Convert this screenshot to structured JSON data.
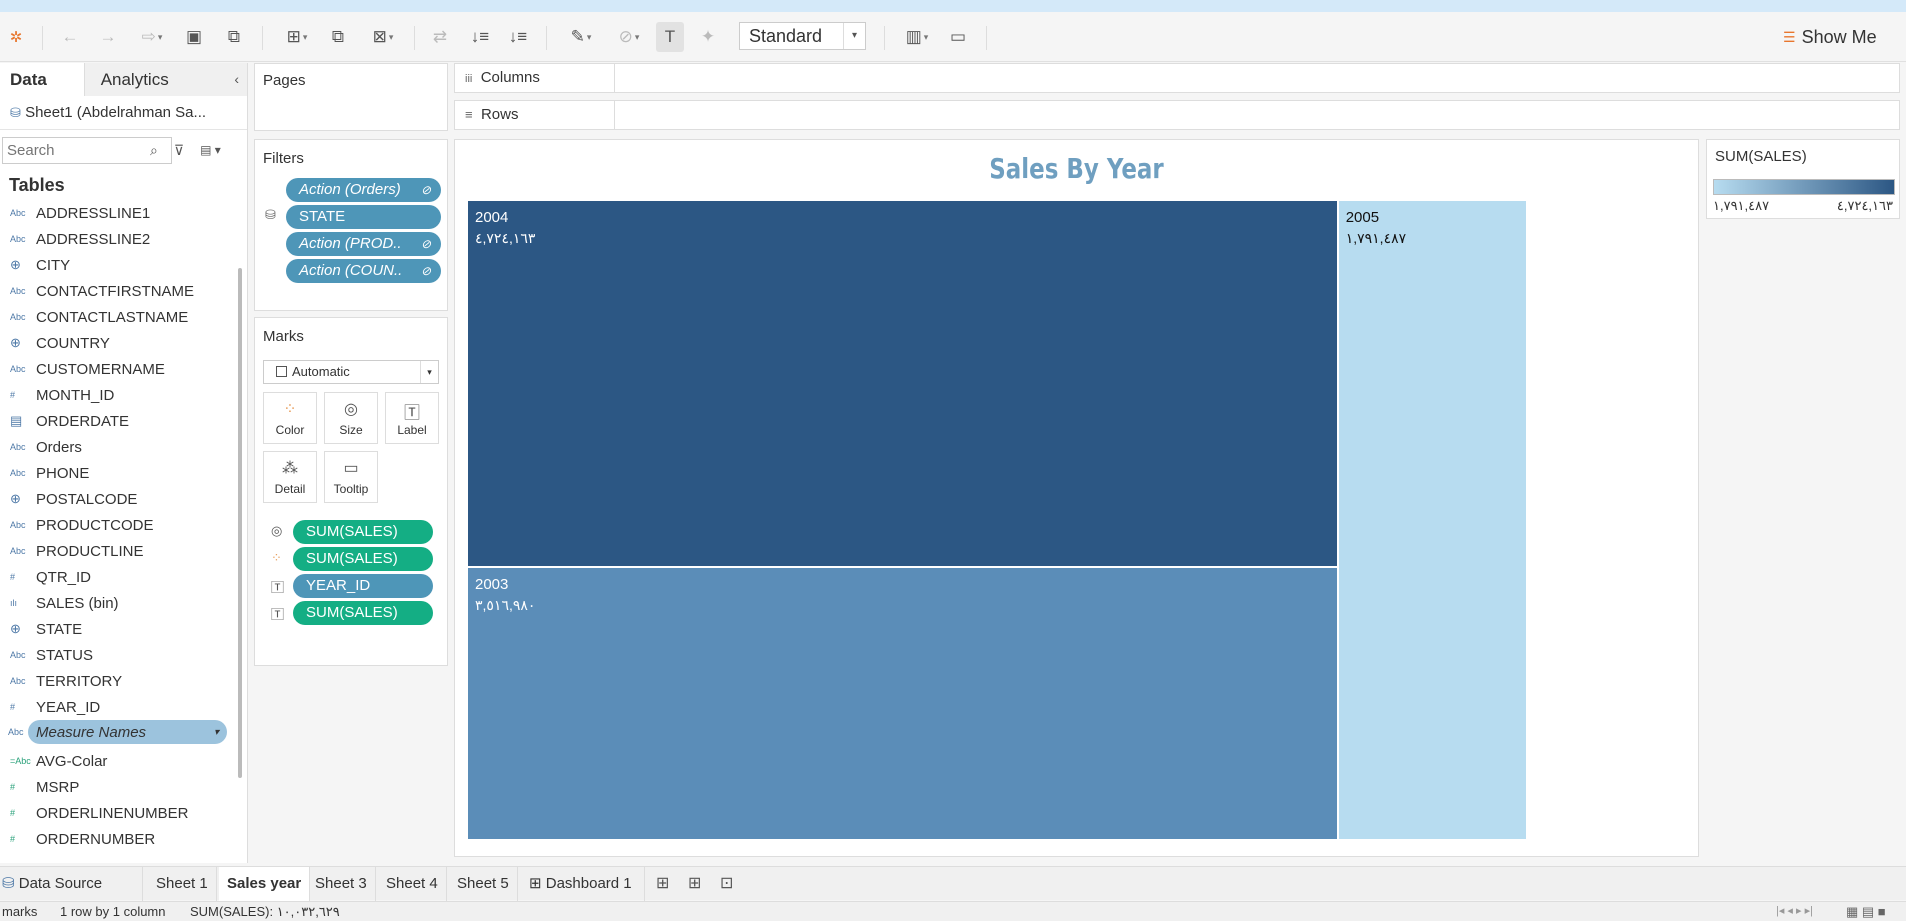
{
  "toolbar": {
    "icons": [
      "tableau-logo-icon",
      "undo-icon",
      "redo-icon",
      "replay-icon",
      "save-icon",
      "new-datasource-icon",
      "new-worksheet-icon",
      "duplicate-icon",
      "clear-sheet-icon",
      "swap-icon",
      "sort-asc-icon",
      "sort-desc-icon",
      "highlight-icon",
      "group-icon",
      "label-icon",
      "pin-icon",
      "presentation-icon"
    ],
    "view_size": "Standard",
    "show_me": "Show Me"
  },
  "datapane": {
    "tab_data": "Data",
    "tab_analytics": "Analytics",
    "datasource": "Sheet1 (Abdelrahman Sa...",
    "search_placeholder": "Search",
    "tables_heading": "Tables",
    "fields": [
      {
        "icon": "Abc",
        "name": "ADDRESSLINE1"
      },
      {
        "icon": "Abc",
        "name": "ADDRESSLINE2"
      },
      {
        "icon": "globe",
        "name": "CITY"
      },
      {
        "icon": "Abc",
        "name": "CONTACTFIRSTNAME"
      },
      {
        "icon": "Abc",
        "name": "CONTACTLASTNAME"
      },
      {
        "icon": "globe",
        "name": "COUNTRY"
      },
      {
        "icon": "Abc",
        "name": "CUSTOMERNAME"
      },
      {
        "icon": "#",
        "name": "MONTH_ID"
      },
      {
        "icon": "date",
        "name": "ORDERDATE"
      },
      {
        "icon": "Abc",
        "name": "Orders"
      },
      {
        "icon": "Abc",
        "name": "PHONE"
      },
      {
        "icon": "globe",
        "name": "POSTALCODE"
      },
      {
        "icon": "Abc",
        "name": "PRODUCTCODE"
      },
      {
        "icon": "Abc",
        "name": "PRODUCTLINE"
      },
      {
        "icon": "#",
        "name": "QTR_ID"
      },
      {
        "icon": "bin",
        "name": "SALES (bin)"
      },
      {
        "icon": "globe",
        "name": "STATE"
      },
      {
        "icon": "Abc",
        "name": "STATUS"
      },
      {
        "icon": "Abc",
        "name": "TERRITORY"
      },
      {
        "icon": "#",
        "name": "YEAR_ID"
      }
    ],
    "measure_names": "Measure Names",
    "measures": [
      {
        "icon": "=Abc",
        "name": "AVG-Colar"
      },
      {
        "icon": "#",
        "name": "MSRP"
      },
      {
        "icon": "#",
        "name": "ORDERLINENUMBER"
      },
      {
        "icon": "#",
        "name": "ORDERNUMBER"
      }
    ]
  },
  "pages": {
    "title": "Pages"
  },
  "filters": {
    "title": "Filters",
    "pills": [
      "Action (Orders)",
      "STATE",
      "Action (PROD..",
      "Action (COUN.."
    ]
  },
  "marks": {
    "title": "Marks",
    "type": "Automatic",
    "buttons": [
      "Color",
      "Size",
      "Label",
      "Detail",
      "Tooltip"
    ],
    "pills": [
      "SUM(SALES)",
      "SUM(SALES)",
      "YEAR_ID",
      "SUM(SALES)"
    ]
  },
  "shelves": {
    "columns": "Columns",
    "rows": "Rows"
  },
  "chart_data": {
    "type": "treemap",
    "title": "Sales By Year",
    "measure": "SUM(SALES)",
    "categories": [
      "2004",
      "2003",
      "2005"
    ],
    "values": [
      4724163,
      3516980,
      1791487
    ],
    "labels": [
      "٤,٧٢٤,١٦٣",
      "٣,٥١٦,٩٨٠",
      "١,٧٩١,٤٨٧"
    ],
    "colors": [
      "#2c5784",
      "#5b8db8",
      "#b7dcf0"
    ]
  },
  "legend": {
    "title": "SUM(SALES)",
    "min": "١,٧٩١,٤٨٧",
    "max": "٤,٧٢٤,١٦٣",
    "color_min": "#b7dcf0",
    "color_max": "#2c5784"
  },
  "sheets": {
    "data_source": "Data Source",
    "tabs": [
      "Sheet 1",
      "Sales year",
      "Sheet 3",
      "Sheet 4",
      "Sheet 5",
      "Dashboard 1"
    ],
    "active": "Sales year"
  },
  "status": {
    "marks": "marks",
    "dims": "1 row by 1 column",
    "sum": "SUM(SALES): ١٠,٠٣٢,٦٢٩"
  }
}
